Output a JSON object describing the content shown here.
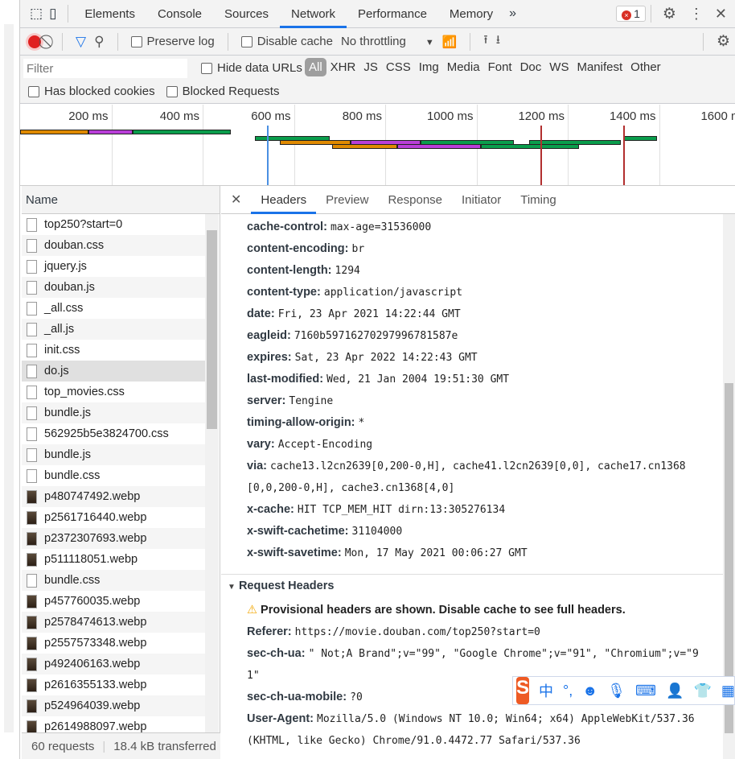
{
  "devtools": {
    "tabs": [
      "Elements",
      "Console",
      "Sources",
      "Network",
      "Performance",
      "Memory"
    ],
    "active_tab": "Network",
    "more_tabs": "»",
    "error_count": "1"
  },
  "toolbar": {
    "preserve_log": "Preserve log",
    "disable_cache": "Disable cache",
    "throttling": "No throttling"
  },
  "filter": {
    "placeholder": "Filter",
    "hide_data_urls": "Hide data URLs",
    "types": [
      "All",
      "XHR",
      "JS",
      "CSS",
      "Img",
      "Media",
      "Font",
      "Doc",
      "WS",
      "Manifest",
      "Other"
    ],
    "active_type": "All",
    "has_blocked_cookies": "Has blocked cookies",
    "blocked_requests": "Blocked Requests"
  },
  "overview": {
    "ticks": [
      "200 ms",
      "400 ms",
      "600 ms",
      "800 ms",
      "1000 ms",
      "1200 ms",
      "1400 ms",
      "1600 ms"
    ],
    "tick_values_ms": [
      200,
      400,
      600,
      800,
      1000,
      1200,
      1400,
      1600
    ],
    "dom_content_loaded_ms": 541,
    "load_markers_ms": [
      1140,
      1322
    ],
    "colors": {
      "waiting": "#e08a00",
      "download": "#b93ed8",
      "receive": "#0a9d4c",
      "dcl": "#4a90e2",
      "load": "#b22f2f"
    },
    "bars": [
      {
        "row": 0,
        "segments": [
          {
            "type": "waiting",
            "start": 0,
            "end": 150
          },
          {
            "type": "download",
            "start": 150,
            "end": 247
          },
          {
            "type": "receive",
            "start": 247,
            "end": 462
          }
        ]
      },
      {
        "row": 1,
        "segments": [
          {
            "type": "receive",
            "start": 515,
            "end": 678
          },
          {
            "type": "receive",
            "start": 1322,
            "end": 1395
          }
        ]
      },
      {
        "row": 2,
        "segments": [
          {
            "type": "waiting",
            "start": 570,
            "end": 725
          },
          {
            "type": "download",
            "start": 725,
            "end": 877
          },
          {
            "type": "receive",
            "start": 877,
            "end": 1082
          },
          {
            "type": "receive",
            "start": 1115,
            "end": 1316
          }
        ]
      },
      {
        "row": 3,
        "segments": [
          {
            "type": "waiting",
            "start": 684,
            "end": 827
          },
          {
            "type": "download",
            "start": 827,
            "end": 1009
          },
          {
            "type": "receive",
            "start": 1009,
            "end": 1224
          }
        ]
      }
    ]
  },
  "requests": {
    "header": "Name",
    "items": [
      {
        "name": "top250?start=0",
        "kind": "doc"
      },
      {
        "name": "douban.css",
        "kind": "doc"
      },
      {
        "name": "jquery.js",
        "kind": "doc"
      },
      {
        "name": "douban.js",
        "kind": "doc"
      },
      {
        "name": "_all.css",
        "kind": "doc"
      },
      {
        "name": "_all.js",
        "kind": "doc"
      },
      {
        "name": "init.css",
        "kind": "doc"
      },
      {
        "name": "do.js",
        "kind": "doc",
        "selected": true
      },
      {
        "name": "top_movies.css",
        "kind": "doc"
      },
      {
        "name": "bundle.js",
        "kind": "doc"
      },
      {
        "name": "562925b5e3824700.css",
        "kind": "doc"
      },
      {
        "name": "bundle.js",
        "kind": "doc"
      },
      {
        "name": "bundle.css",
        "kind": "doc"
      },
      {
        "name": "p480747492.webp",
        "kind": "img"
      },
      {
        "name": "p2561716440.webp",
        "kind": "img"
      },
      {
        "name": "p2372307693.webp",
        "kind": "img"
      },
      {
        "name": "p511118051.webp",
        "kind": "img"
      },
      {
        "name": "bundle.css",
        "kind": "doc"
      },
      {
        "name": "p457760035.webp",
        "kind": "img"
      },
      {
        "name": "p2578474613.webp",
        "kind": "img"
      },
      {
        "name": "p2557573348.webp",
        "kind": "img"
      },
      {
        "name": "p492406163.webp",
        "kind": "img"
      },
      {
        "name": "p2616355133.webp",
        "kind": "img"
      },
      {
        "name": "p524964039.webp",
        "kind": "img"
      },
      {
        "name": "p2614988097.webp",
        "kind": "img"
      }
    ],
    "count": "60 requests",
    "transferred": "18.4 kB transferred"
  },
  "details": {
    "tabs": [
      "Headers",
      "Preview",
      "Response",
      "Initiator",
      "Timing"
    ],
    "active_tab": "Headers",
    "response_headers": [
      {
        "k": "cache-control:",
        "v": "max-age=31536000"
      },
      {
        "k": "content-encoding:",
        "v": "br"
      },
      {
        "k": "content-length:",
        "v": "1294"
      },
      {
        "k": "content-type:",
        "v": "application/javascript"
      },
      {
        "k": "date:",
        "v": "Fri, 23 Apr 2021 14:22:44 GMT"
      },
      {
        "k": "eagleid:",
        "v": "7160b59716270297996781587e"
      },
      {
        "k": "expires:",
        "v": "Sat, 23 Apr 2022 14:22:43 GMT"
      },
      {
        "k": "last-modified:",
        "v": "Wed, 21 Jan 2004 19:51:30 GMT"
      },
      {
        "k": "server:",
        "v": "Tengine"
      },
      {
        "k": "timing-allow-origin:",
        "v": "*"
      },
      {
        "k": "vary:",
        "v": "Accept-Encoding"
      },
      {
        "k": "via:",
        "v": "cache13.l2cn2639[0,200-0,H], cache41.l2cn2639[0,0], cache17.cn1368",
        "v2": "[0,0,200-0,H], cache3.cn1368[4,0]"
      },
      {
        "k": "x-cache:",
        "v": "HIT TCP_MEM_HIT dirn:13:305276134"
      },
      {
        "k": "x-swift-cachetime:",
        "v": "31104000"
      },
      {
        "k": "x-swift-savetime:",
        "v": "Mon, 17 May 2021 00:06:27 GMT"
      }
    ],
    "request_section": "Request Headers",
    "provisional_warning": "Provisional headers are shown. Disable cache to see full headers.",
    "request_headers": [
      {
        "k": "Referer:",
        "v": "https://movie.douban.com/top250?start=0"
      },
      {
        "k": "sec-ch-ua:",
        "v": "\" Not;A Brand\";v=\"99\", \"Google Chrome\";v=\"91\", \"Chromium\";v=\"9",
        "v2": "1\""
      },
      {
        "k": "sec-ch-ua-mobile:",
        "v": "?0"
      },
      {
        "k": "User-Agent:",
        "v": "Mozilla/5.0 (Windows NT 10.0; Win64; x64) AppleWebKit/537.36",
        "v2": "(KHTML, like Gecko) Chrome/91.0.4472.77 Safari/537.36"
      }
    ]
  },
  "ime": {
    "zh": "中",
    "punct": "°,"
  }
}
